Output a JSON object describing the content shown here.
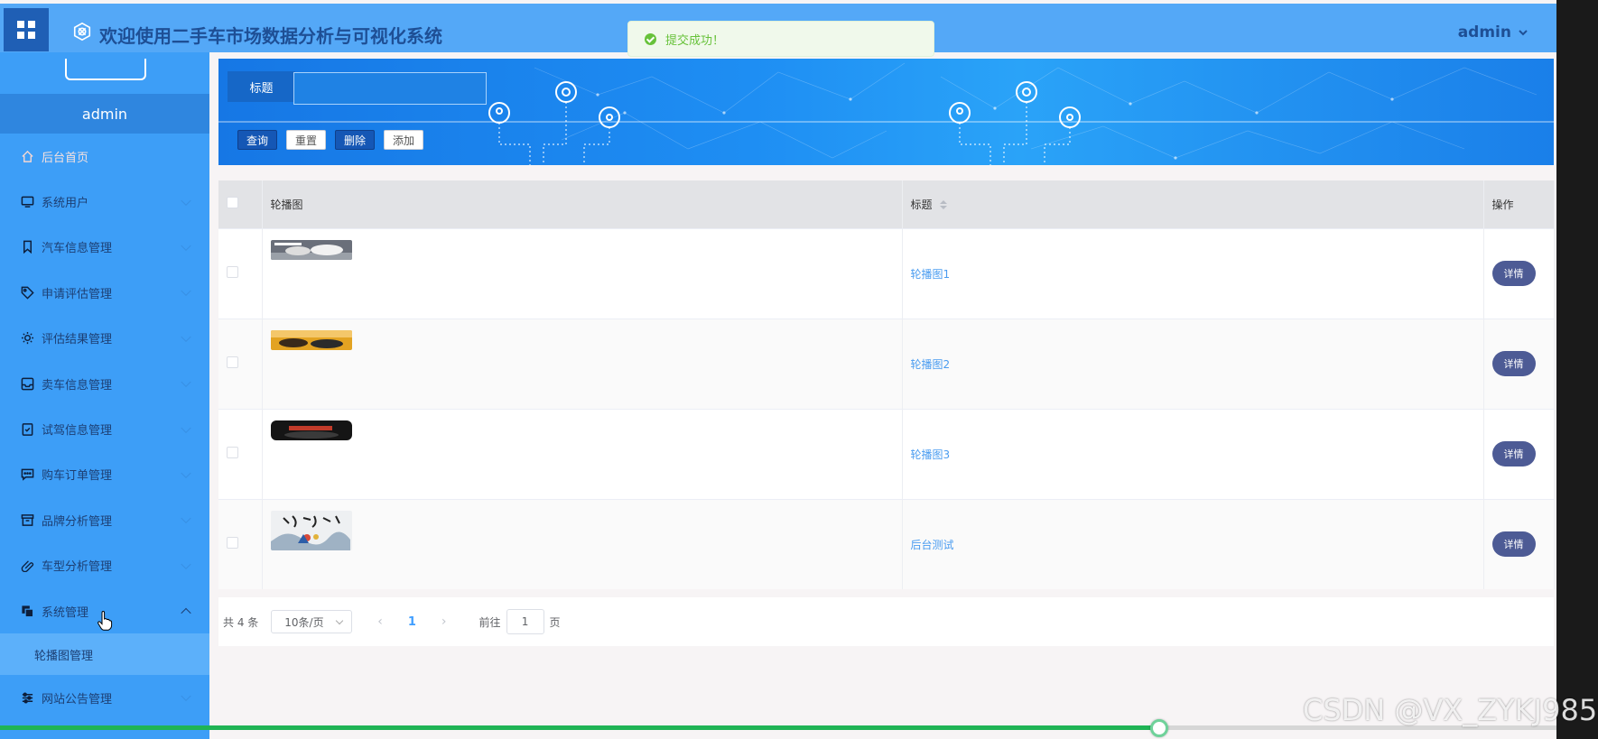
{
  "header": {
    "title": "欢迎使用二手车市场数据分析与可视化系统",
    "user": "admin",
    "bg_color": "#54a8f7"
  },
  "toast": {
    "message": "提交成功！",
    "color": "#67c23a"
  },
  "sidebar": {
    "user": "admin",
    "items": [
      {
        "label": "后台首页",
        "icon": "home-icon"
      },
      {
        "label": "系统用户",
        "icon": "monitor-icon"
      },
      {
        "label": "汽车信息管理",
        "icon": "bookmark-icon"
      },
      {
        "label": "申请评估管理",
        "icon": "tag-icon"
      },
      {
        "label": "评估结果管理",
        "icon": "sun-icon"
      },
      {
        "label": "卖车信息管理",
        "icon": "inbox-icon"
      },
      {
        "label": "试驾信息管理",
        "icon": "clipboard-check-icon"
      },
      {
        "label": "购车订单管理",
        "icon": "chat-icon"
      },
      {
        "label": "品牌分析管理",
        "icon": "archive-icon"
      },
      {
        "label": "车型分析管理",
        "icon": "paperclip-icon"
      },
      {
        "label": "系统管理",
        "icon": "copy-icon"
      },
      {
        "label": "网站公告管理",
        "icon": "sliders-icon"
      }
    ],
    "submenu_active": "轮播图管理"
  },
  "search": {
    "label": "标题",
    "value": "",
    "buttons": {
      "query": "查询",
      "reset": "重置",
      "delete": "删除",
      "add": "添加"
    }
  },
  "table": {
    "columns": {
      "image": "轮播图",
      "title": "标题",
      "action": "操作"
    },
    "detail_label": "详情",
    "rows": [
      {
        "title": "轮播图1",
        "thumb": "car-banner-white"
      },
      {
        "title": "轮播图2",
        "thumb": "car-banner-gold"
      },
      {
        "title": "轮播图3",
        "thumb": "car-banner-dark"
      },
      {
        "title": "后台测试",
        "thumb": "calligraphy-banner"
      }
    ]
  },
  "pagination": {
    "total": "共 4 条",
    "page_size": "10条/页",
    "current_page": "1",
    "goto_prefix": "前往",
    "goto_value": "1",
    "goto_suffix": "页"
  },
  "video": {
    "progress": 0.745
  },
  "watermark": "CSDN @VX_ZYKJ985"
}
